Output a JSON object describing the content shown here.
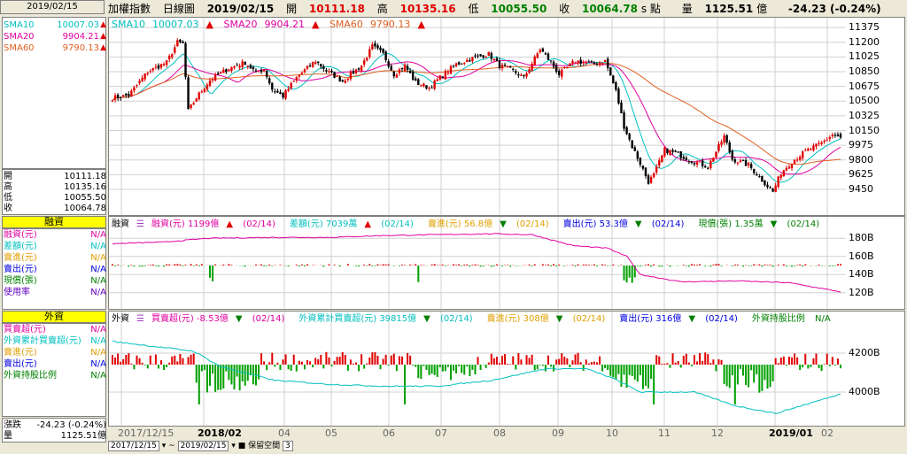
{
  "left": {
    "date": "2019/02/15",
    "sma": [
      {
        "name": "SMA10",
        "value": "10007.03"
      },
      {
        "name": "SMA20",
        "value": "9904.21"
      },
      {
        "name": "SMA60",
        "value": "9790.13"
      }
    ],
    "ohlc": [
      {
        "name": "開",
        "value": "10111.18"
      },
      {
        "name": "高",
        "value": "10135.16"
      },
      {
        "name": "低",
        "value": "10055.50"
      },
      {
        "name": "收",
        "value": "10064.78"
      }
    ],
    "margin": {
      "title": "融資",
      "rows": [
        {
          "name": "融資(元)",
          "value": "N/A",
          "color": "#e000a0"
        },
        {
          "name": "差額(元)",
          "value": "N/A",
          "color": "#00bfbf"
        },
        {
          "name": "賣進(元)",
          "value": "N/A",
          "color": "#e0a000"
        },
        {
          "name": "賣出(元)",
          "value": "N/A",
          "color": "#0000e0"
        },
        {
          "name": "現償(張)",
          "value": "N/A",
          "color": "#008000"
        },
        {
          "name": "使用率",
          "value": "N/A",
          "color": "#6000c0"
        }
      ]
    },
    "foreign": {
      "title": "外資",
      "rows": [
        {
          "name": "買賣超(元)",
          "value": "N/A",
          "color": "#e000a0"
        },
        {
          "name": "外資累計買賣超(元)",
          "value": "N/A",
          "color": "#00bfbf"
        },
        {
          "name": "賣進(元)",
          "value": "N/A",
          "color": "#e0a000"
        },
        {
          "name": "賣出(元)",
          "value": "N/A",
          "color": "#0000e0"
        },
        {
          "name": "外資持股比例",
          "value": "N/A",
          "color": "#008000"
        }
      ]
    },
    "bottom": [
      {
        "name": "漲跌",
        "value": "-24.23 (-0.24%)"
      },
      {
        "name": "量",
        "value": "1125.51億"
      }
    ]
  },
  "header": {
    "index_name": "加權指數",
    "period": "日線圖",
    "date": "2019/02/15",
    "open_label": "開",
    "open": "10111.18",
    "high_label": "高",
    "high": "10135.16",
    "low_label": "低",
    "low": "10055.50",
    "close_label": "收",
    "close": "10064.78",
    "unit": "s 點",
    "volume_label": "量",
    "volume": "1125.51",
    "volume_unit": "億",
    "change": "-24.23 (-0.24%)"
  },
  "price_legend": [
    "10007.03",
    "9904.21",
    "9790.13"
  ],
  "margin_legend": [
    {
      "text": "融資(元) 1199億",
      "date": "(02/14)",
      "color": "#e000a0",
      "arrow": "▲",
      "arrow_color": "#e00000"
    },
    {
      "text": "差額(元) 7039萬",
      "date": "(02/14)",
      "color": "#00bfbf",
      "arrow": "▲",
      "arrow_color": "#e00000"
    },
    {
      "text": "賣進(元) 56.8億",
      "date": "(02/14)",
      "color": "#e0a000",
      "arrow": "▼",
      "arrow_color": "#008000"
    },
    {
      "text": "賣出(元) 53.3億",
      "date": "(02/14)",
      "color": "#0000e0",
      "arrow": "▼",
      "arrow_color": "#008000"
    },
    {
      "text": "現償(張) 1.35萬",
      "date": "(02/14)",
      "color": "#008000",
      "arrow": "▼",
      "arrow_color": "#008000"
    }
  ],
  "foreign_legend": [
    {
      "text": "買賣超(元) -8.53億",
      "date": "(02/14)",
      "color": "#e000a0",
      "arrow": "▼",
      "arrow_color": "#008000"
    },
    {
      "text": "外資累計買賣超(元) 39815億",
      "date": "(02/14)",
      "color": "#00bfbf",
      "arrow": "▼",
      "arrow_color": "#008000"
    },
    {
      "text": "賣進(元) 308億",
      "date": "(02/14)",
      "color": "#e0a000",
      "arrow": "▼",
      "arrow_color": "#008000"
    },
    {
      "text": "賣出(元) 316億",
      "date": "(02/14)",
      "color": "#0000e0",
      "arrow": "▼",
      "arrow_color": "#008000"
    },
    {
      "text": "外資持股比例",
      "date": "N/A",
      "color": "#008000",
      "arrow": "",
      "arrow_color": "#008000"
    }
  ],
  "margin_panel_label": "融資",
  "foreign_panel_label": "外資",
  "bottom_bar": {
    "start": "2017/12/15",
    "sep": "~",
    "end": "2019/02/15",
    "keep_label": "保留空間",
    "keep_value": "3"
  },
  "chart_data": [
    {
      "type": "line",
      "title": "加權指數 日線圖",
      "x_ticks": [
        "2017/12/15",
        "2018/02",
        "04",
        "05",
        "06",
        "07",
        "08",
        "09",
        "10",
        "11",
        "12",
        "2019/01",
        "02"
      ],
      "ylim": [
        9250,
        11450
      ],
      "y_ticks": [
        11375,
        11200,
        11025,
        10850,
        10675,
        10500,
        10325,
        10150,
        9975,
        9800,
        9625,
        9450
      ],
      "series": [
        {
          "name": "SMA10",
          "color": "#00bfbf"
        },
        {
          "name": "SMA20",
          "color": "#e000a0"
        },
        {
          "name": "SMA60",
          "color": "#e06020"
        }
      ],
      "close_anchors": [
        [
          0,
          10540
        ],
        [
          6,
          10570
        ],
        [
          13,
          10850
        ],
        [
          20,
          10960
        ],
        [
          24,
          11200
        ],
        [
          26,
          11180
        ],
        [
          28,
          10380
        ],
        [
          31,
          10540
        ],
        [
          36,
          10750
        ],
        [
          43,
          10890
        ],
        [
          49,
          10960
        ],
        [
          53,
          10840
        ],
        [
          56,
          10880
        ],
        [
          59,
          10640
        ],
        [
          63,
          10560
        ],
        [
          68,
          10780
        ],
        [
          75,
          10980
        ],
        [
          79,
          10860
        ],
        [
          85,
          10740
        ],
        [
          92,
          10920
        ],
        [
          96,
          11150
        ],
        [
          100,
          11060
        ],
        [
          104,
          10820
        ],
        [
          108,
          10920
        ],
        [
          112,
          10720
        ],
        [
          117,
          10660
        ],
        [
          121,
          10780
        ],
        [
          127,
          10940
        ],
        [
          134,
          11020
        ],
        [
          139,
          11060
        ],
        [
          143,
          10920
        ],
        [
          148,
          10860
        ],
        [
          152,
          10780
        ],
        [
          158,
          11120
        ],
        [
          162,
          10960
        ],
        [
          165,
          10820
        ],
        [
          171,
          10980
        ],
        [
          177,
          10940
        ],
        [
          182,
          10980
        ],
        [
          186,
          10620
        ],
        [
          189,
          10200
        ],
        [
          192,
          9960
        ],
        [
          195,
          9760
        ],
        [
          198,
          9540
        ],
        [
          200,
          9620
        ],
        [
          204,
          9920
        ],
        [
          208,
          9880
        ],
        [
          214,
          9790
        ],
        [
          220,
          9720
        ],
        [
          226,
          10080
        ],
        [
          229,
          9810
        ],
        [
          235,
          9740
        ],
        [
          240,
          9560
        ],
        [
          244,
          9420
        ],
        [
          247,
          9650
        ],
        [
          251,
          9780
        ],
        [
          256,
          9900
        ],
        [
          262,
          10000
        ],
        [
          266,
          10100
        ],
        [
          269,
          10065
        ]
      ],
      "sma_values": {
        "SMA10": 10007.03,
        "SMA20": 9904.21,
        "SMA60": 9790.13
      }
    },
    {
      "type": "bar",
      "title": "融資",
      "y_ticks": [
        "180B",
        "160B",
        "140B",
        "120B"
      ],
      "ylim": [
        110,
        190
      ],
      "margin_balance_anchors": [
        [
          0,
          174
        ],
        [
          20,
          176
        ],
        [
          35,
          180
        ],
        [
          60,
          181
        ],
        [
          80,
          181
        ],
        [
          100,
          183
        ],
        [
          120,
          184
        ],
        [
          140,
          185
        ],
        [
          155,
          184
        ],
        [
          170,
          172
        ],
        [
          183,
          169
        ],
        [
          190,
          160
        ],
        [
          195,
          140
        ],
        [
          210,
          132
        ],
        [
          230,
          133
        ],
        [
          250,
          131
        ],
        [
          269,
          121
        ]
      ]
    },
    {
      "type": "bar",
      "title": "外資",
      "y_ticks": [
        "4200B",
        "4000B"
      ],
      "ylim": [
        3850,
        4350
      ],
      "cumulative_anchors": [
        [
          0,
          4260
        ],
        [
          30,
          4210
        ],
        [
          40,
          4130
        ],
        [
          60,
          4060
        ],
        [
          80,
          4040
        ],
        [
          100,
          4030
        ],
        [
          120,
          4030
        ],
        [
          140,
          4060
        ],
        [
          160,
          4120
        ],
        [
          175,
          4120
        ],
        [
          185,
          4070
        ],
        [
          195,
          4000
        ],
        [
          215,
          4000
        ],
        [
          230,
          3930
        ],
        [
          245,
          3890
        ],
        [
          269,
          3990
        ]
      ]
    }
  ]
}
